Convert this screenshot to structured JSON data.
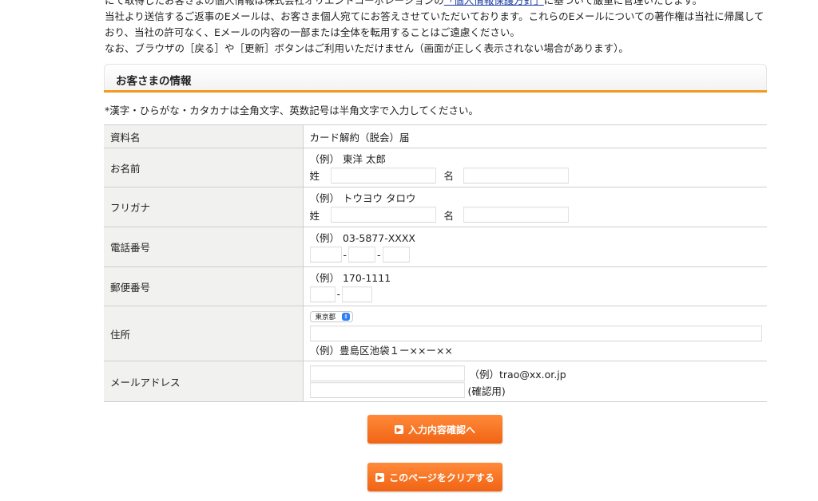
{
  "intro": {
    "line1_pre": "にて取得したお客さまの個人情報は株式会社オリエントコーポレーションの",
    "line1_link": "「個人情報保護方針」",
    "line1_post": "に基づいて厳重に管理いたします。",
    "line2": "当社より送信するご返事のEメールは、お客さま個人宛てにお答えさせていただいております。これらのEメールについての著作権は当社に帰属して",
    "line3": "おり、当社の許可なく、Eメールの内容の一部または全体を転用することはご遠慮ください。",
    "line4": "なお、ブラウザの［戻る］や［更新］ボタンはご利用いただけません（画面が正しく表示されない場合があります）。"
  },
  "section": {
    "title": "お客さまの情報",
    "note": "*漢字・ひらがな・カタカナは全角文字、英数記号は半角文字で入力してください。"
  },
  "form": {
    "document": {
      "label": "資料名",
      "value": "カード解約（脱会）届"
    },
    "name": {
      "label": "お名前",
      "example": "（例） 東洋 太郎",
      "last_label": "姓",
      "first_label": "名"
    },
    "furigana": {
      "label": "フリガナ",
      "example": "（例） トウヨウ タロウ",
      "last_label": "姓",
      "first_label": "名"
    },
    "phone": {
      "label": "電話番号",
      "example": "（例） 03-5877-XXXX",
      "sep": "-"
    },
    "postal": {
      "label": "郵便番号",
      "example": "（例） 170-1111",
      "sep": "-"
    },
    "address": {
      "label": "住所",
      "prefecture": "東京都",
      "example": "（例）豊島区池袋１ー××ー××"
    },
    "email": {
      "label": "メールアドレス",
      "example": "（例）trao@xx.or.jp",
      "confirm": "(確認用)"
    }
  },
  "buttons": {
    "confirm": "入力内容確認へ",
    "clear": "このページをクリアする"
  },
  "colors": {
    "accent": "#f39a1e",
    "button": "#f06414",
    "link": "#1a3a9e"
  }
}
